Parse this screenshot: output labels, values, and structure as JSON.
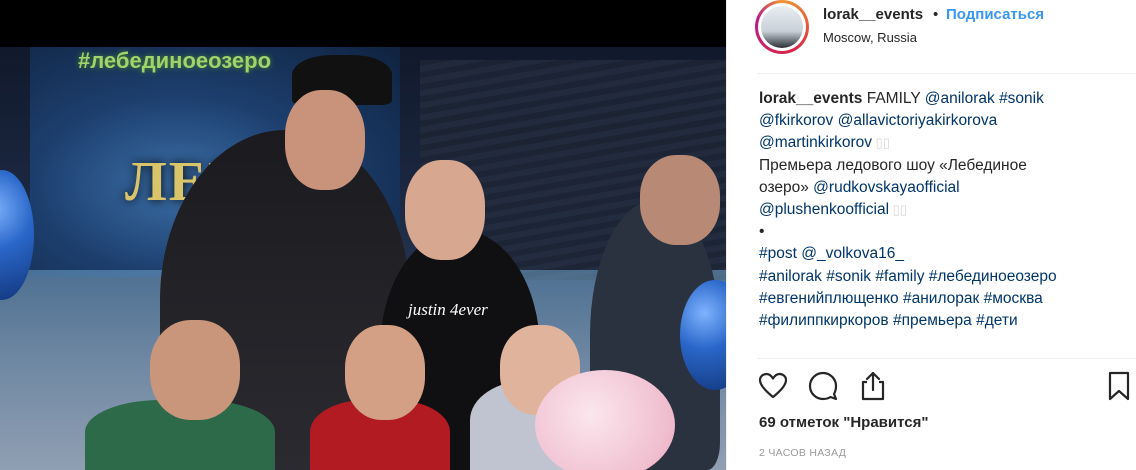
{
  "post": {
    "username": "lorak__events",
    "separator": "•",
    "follow_label": "Подписаться",
    "location": "Moscow, Russia",
    "photo": {
      "screen_hashtag": "#лебединоеозеро",
      "screen_title": "ЛЕБ",
      "shirt_text": "justin 4ever"
    },
    "caption": {
      "author": "lorak__events",
      "lines": [
        [
          {
            "t": "FAMILY ",
            "k": "text"
          },
          {
            "t": "@anilorak",
            "k": "tag"
          },
          {
            "t": " ",
            "k": "text"
          },
          {
            "t": "#sonik",
            "k": "tag"
          }
        ],
        [
          {
            "t": "@fkirkorov",
            "k": "tag"
          },
          {
            "t": " ",
            "k": "text"
          },
          {
            "t": "@allavictoriyakirkorova",
            "k": "tag"
          }
        ],
        [
          {
            "t": "@martinkirkorov",
            "k": "tag"
          },
          {
            "t": " ▯▯",
            "k": "ghost"
          }
        ],
        [
          {
            "t": "Премьера ледового шоу «Лебединое",
            "k": "text"
          }
        ],
        [
          {
            "t": "озеро» ",
            "k": "text"
          },
          {
            "t": "@rudkovskayaofficial",
            "k": "tag"
          }
        ],
        [
          {
            "t": "@plushenkoofficial",
            "k": "tag"
          },
          {
            "t": " ▯▯",
            "k": "ghost"
          }
        ],
        [
          {
            "t": "•",
            "k": "text"
          }
        ],
        [
          {
            "t": "#post",
            "k": "tag"
          },
          {
            "t": " ",
            "k": "text"
          },
          {
            "t": "@_volkova16_",
            "k": "tag"
          }
        ],
        [
          {
            "t": "#anilorak",
            "k": "tag"
          },
          {
            "t": " ",
            "k": "text"
          },
          {
            "t": "#sonik",
            "k": "tag"
          },
          {
            "t": " ",
            "k": "text"
          },
          {
            "t": "#family",
            "k": "tag"
          },
          {
            "t": " ",
            "k": "text"
          },
          {
            "t": "#лебединоеозеро",
            "k": "tag"
          }
        ],
        [
          {
            "t": "#евгенийплющенко",
            "k": "tag"
          },
          {
            "t": " ",
            "k": "text"
          },
          {
            "t": "#анилорак",
            "k": "tag"
          },
          {
            "t": " ",
            "k": "text"
          },
          {
            "t": "#москва",
            "k": "tag"
          }
        ],
        [
          {
            "t": "#филиппкиркоров",
            "k": "tag"
          },
          {
            "t": " ",
            "k": "text"
          },
          {
            "t": "#премьера",
            "k": "tag"
          },
          {
            "t": " ",
            "k": "text"
          },
          {
            "t": "#дети",
            "k": "tag"
          }
        ]
      ]
    },
    "actions": {
      "like_icon": "heart-icon",
      "comment_icon": "comment-icon",
      "share_icon": "share-icon",
      "save_icon": "bookmark-icon"
    },
    "likes": "69 отметок \"Нравится\"",
    "time": "2 ЧАСОВ НАЗАД"
  },
  "colors": {
    "text": "#262626",
    "follow": "#3897f0",
    "tag": "#003569",
    "time": "#999999",
    "divider": "#efefef"
  }
}
